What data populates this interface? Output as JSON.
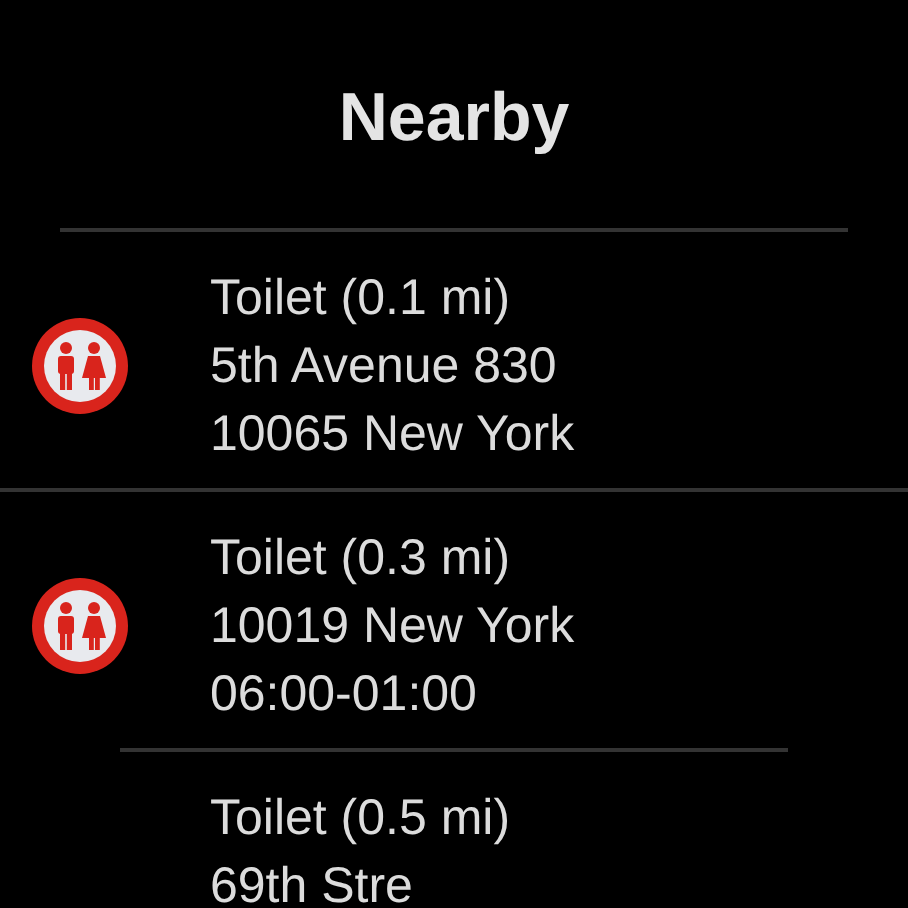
{
  "title": "Nearby",
  "places": [
    {
      "kind": "toilet",
      "lines": [
        "Toilet (0.1 mi)",
        "5th Avenue 830",
        "10065 New York"
      ]
    },
    {
      "kind": "toilet",
      "lines": [
        "Toilet (0.3 mi)",
        "10019 New York",
        "06:00-01:00"
      ]
    },
    {
      "lines": [
        "Toilet (0.5 mi)",
        "69th Stre"
      ]
    }
  ]
}
